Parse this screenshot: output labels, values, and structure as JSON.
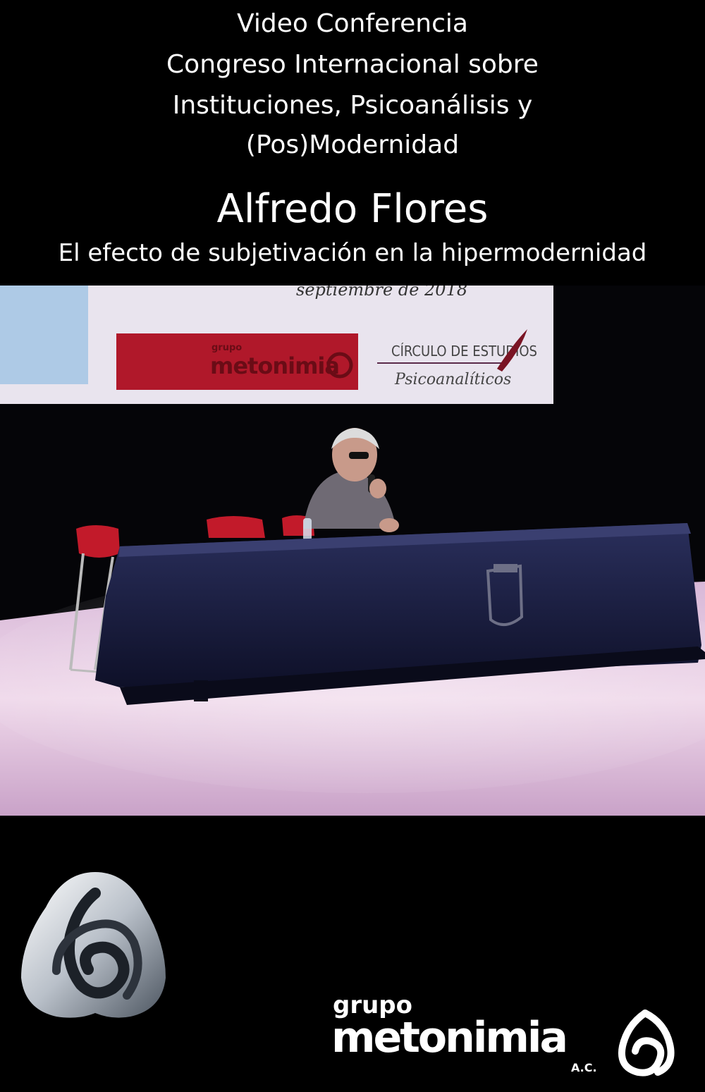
{
  "header": {
    "line1": "Video Conferencia",
    "line2": "Congreso Internacional sobre",
    "line3": "Instituciones, Psicoanálisis y",
    "line4": "(Pos)Modernidad",
    "speaker": "Alfredo Flores",
    "talk_title": "El efecto de subjetivación en la hipermodernidad"
  },
  "photo": {
    "banner_date": "septiembre de 2018",
    "banner_logo_left_small": "grupo",
    "banner_logo_left": "metonimia",
    "banner_logo_right_top": "CÍRCULO DE ESTUDIOS",
    "banner_logo_right_bottom": "Psicoanalíticos"
  },
  "footer": {
    "brand_small": "grupo",
    "brand_name": "metonimia",
    "brand_suffix": "A.C."
  },
  "colors": {
    "background": "#000000",
    "banner_red": "#b0182a",
    "table_cloth": "#161a3a",
    "stage_floor": "#e8cfe6"
  }
}
